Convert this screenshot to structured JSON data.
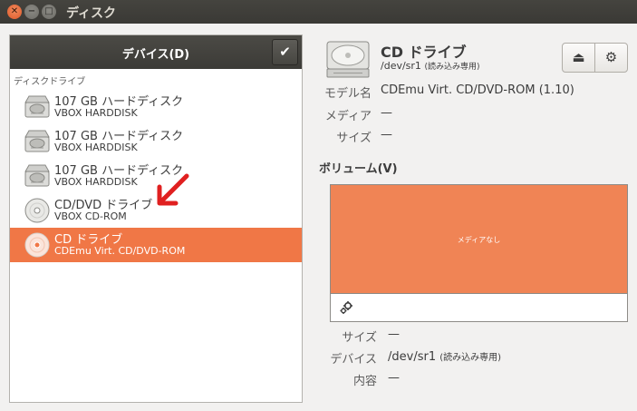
{
  "window": {
    "title": "ディスク"
  },
  "sidebar": {
    "header_title": "デバイス(D)",
    "section_label": "ディスクドライブ",
    "items": [
      {
        "name": "107 GB ハードディスク",
        "sub": "VBOX HARDDISK",
        "icon": "harddisk-icon"
      },
      {
        "name": "107 GB ハードディスク",
        "sub": "VBOX HARDDISK",
        "icon": "harddisk-icon"
      },
      {
        "name": "107 GB ハードディスク",
        "sub": "VBOX HARDDISK",
        "icon": "harddisk-icon"
      },
      {
        "name": "CD/DVD ドライブ",
        "sub": "VBOX CD-ROM",
        "icon": "optical-disc-icon"
      },
      {
        "name": "CD ドライブ",
        "sub": "CDEmu Virt. CD/DVD-ROM",
        "icon": "optical-disc-icon",
        "selected": true
      }
    ]
  },
  "drive": {
    "title": "CD ドライブ",
    "path": "/dev/sr1",
    "path_note": "(読み込み専用)",
    "props": [
      {
        "label": "モデル名",
        "value": "CDEmu Virt. CD/DVD-ROM (1.10)"
      },
      {
        "label": "メディア",
        "value": "—"
      },
      {
        "label": "サイズ",
        "value": "—"
      }
    ]
  },
  "volumes": {
    "heading": "ボリューム(V)",
    "bar_label": "メディアなし",
    "bar_color": "#f08455",
    "props": [
      {
        "label": "サイズ",
        "value": "—"
      },
      {
        "label": "デバイス",
        "value": "/dev/sr1",
        "note": "(読み込み専用)"
      },
      {
        "label": "内容",
        "value": "—"
      }
    ]
  },
  "colors": {
    "accent": "#f07746",
    "titlebar": "#3c3b37",
    "annotation_arrow": "#e02020"
  }
}
